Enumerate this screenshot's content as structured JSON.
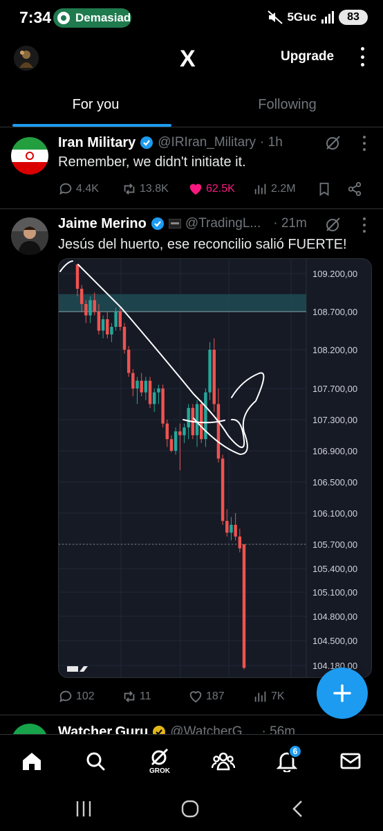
{
  "status_bar": {
    "time": "7:34",
    "pill_text": "Demasiado",
    "network": "5Guc",
    "battery": "83"
  },
  "header": {
    "logo": "X",
    "upgrade_label": "Upgrade"
  },
  "tabs": [
    {
      "label": "For you",
      "active": true
    },
    {
      "label": "Following",
      "active": false
    }
  ],
  "posts": [
    {
      "name": "Iran Military",
      "handle": "@IRIran_Military",
      "time": "· 1h",
      "text": "Remember, we didn't initiate it.",
      "replies": "4.4K",
      "reposts": "13.8K",
      "likes": "62.5K",
      "views": "2.2M"
    },
    {
      "name": "Jaime Merino",
      "handle": "@TradingL...",
      "time": "· 21m",
      "text": "Jesús del huerto, ese reconcilio salió FUERTE!",
      "replies": "102",
      "reposts": "11",
      "likes": "187",
      "views": "7K"
    },
    {
      "name": "Watcher.Guru",
      "handle": "@WatcherG",
      "time": "· 56m"
    }
  ],
  "chart_data": {
    "type": "candlestick",
    "y_ticks": [
      "109.200,00",
      "108.700,00",
      "108.200,00",
      "107.700,00",
      "107.300,00",
      "106.900,00",
      "106.500,00",
      "106.100,00",
      "105.700,00",
      "105.400,00",
      "105.100,00",
      "104.800,00",
      "104.500,00",
      "104.180,00"
    ],
    "zone": [
      108700,
      108930
    ],
    "last_price": 105700,
    "bull_color": "#26a69a",
    "bear_color": "#ef5350",
    "bg_color": "#161a25",
    "zone_color": "#1e4b55",
    "candles": [
      [
        109320,
        109320,
        108900,
        109000
      ],
      [
        109000,
        109050,
        108700,
        108800
      ],
      [
        108800,
        108850,
        108550,
        108650
      ],
      [
        108650,
        108900,
        108550,
        108850
      ],
      [
        108850,
        108950,
        108650,
        108700
      ],
      [
        108700,
        108800,
        108400,
        108450
      ],
      [
        108450,
        108650,
        108350,
        108600
      ],
      [
        108600,
        108700,
        108350,
        108400
      ],
      [
        108400,
        108550,
        108300,
        108500
      ],
      [
        108500,
        108750,
        108450,
        108700
      ],
      [
        108700,
        108760,
        108450,
        108500
      ],
      [
        108500,
        108550,
        108150,
        108200
      ],
      [
        108200,
        108250,
        107850,
        107900
      ],
      [
        107900,
        107950,
        107600,
        107700
      ],
      [
        107700,
        107850,
        107500,
        107800
      ],
      [
        107800,
        107900,
        107600,
        107650
      ],
      [
        107650,
        107850,
        107550,
        107800
      ],
      [
        107800,
        107850,
        107450,
        107500
      ],
      [
        107500,
        107700,
        107400,
        107650
      ],
      [
        107650,
        107750,
        107500,
        107700
      ],
      [
        107700,
        107750,
        107200,
        107250
      ],
      [
        107250,
        107300,
        106950,
        107050
      ],
      [
        107050,
        107100,
        106880,
        106900
      ],
      [
        106900,
        107200,
        106850,
        107150
      ],
      [
        107150,
        107250,
        106650,
        107100
      ],
      [
        107100,
        107250,
        107000,
        107200
      ],
      [
        107200,
        107500,
        107050,
        107450
      ],
      [
        107450,
        107500,
        107050,
        107100
      ],
      [
        107100,
        107550,
        106950,
        107500
      ],
      [
        107500,
        107550,
        107000,
        107050
      ],
      [
        107050,
        107700,
        106950,
        107650
      ],
      [
        107650,
        108300,
        107550,
        108200
      ],
      [
        108200,
        108350,
        107400,
        107500
      ],
      [
        107500,
        107700,
        106750,
        106800
      ],
      [
        106800,
        106850,
        105950,
        106000
      ],
      [
        106000,
        106150,
        105800,
        105850
      ],
      [
        105850,
        106050,
        105750,
        105950
      ],
      [
        105950,
        106100,
        105750,
        105800
      ],
      [
        105800,
        105900,
        105600,
        105650
      ],
      [
        105700,
        105700,
        104130,
        104150
      ]
    ]
  },
  "bottom_nav": {
    "grok_label": "GROK",
    "notifications_badge": "6"
  }
}
